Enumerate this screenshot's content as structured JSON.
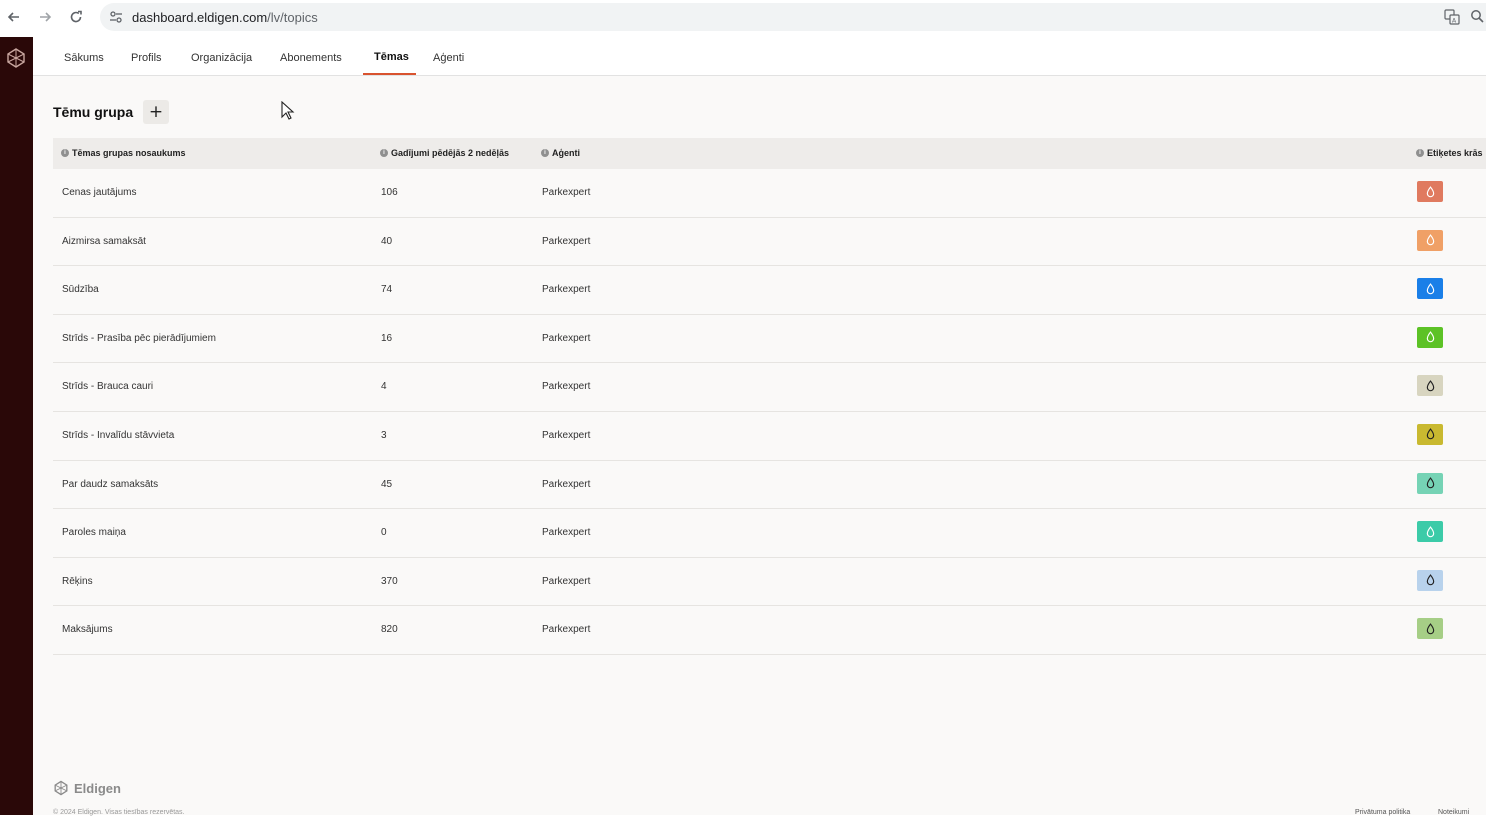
{
  "browser": {
    "url_host": "dashboard.eldigen.com",
    "url_path": "/lv/topics"
  },
  "tabs": [
    {
      "label": "Sākums",
      "active": false
    },
    {
      "label": "Profils",
      "active": false
    },
    {
      "label": "Organizācija",
      "active": false
    },
    {
      "label": "Abonements",
      "active": false
    },
    {
      "label": "Tēmas",
      "active": true
    },
    {
      "label": "Aģenti",
      "active": false
    }
  ],
  "section": {
    "title": "Tēmu grupa",
    "add_label": "+"
  },
  "table": {
    "columns": [
      "Tēmas grupas nosaukums",
      "Gadījumi pēdējās 2 nedēļās",
      "Aģenti",
      "Etiķetes krās"
    ],
    "rows": [
      {
        "name": "Cenas jautājums",
        "cases": "106",
        "agent": "Parkexpert",
        "color": "#e07a5f"
      },
      {
        "name": "Aizmirsa samaksāt",
        "cases": "40",
        "agent": "Parkexpert",
        "color": "#f0a066"
      },
      {
        "name": "Sūdzība",
        "cases": "74",
        "agent": "Parkexpert",
        "color": "#1a7fe8"
      },
      {
        "name": "Strīds - Prasība pēc pierādījumiem",
        "cases": "16",
        "agent": "Parkexpert",
        "color": "#5cc226"
      },
      {
        "name": "Strīds - Brauca cauri",
        "cases": "4",
        "agent": "Parkexpert",
        "color": "#d8d5c0"
      },
      {
        "name": "Strīds - Invalīdu stāvvieta",
        "cases": "3",
        "agent": "Parkexpert",
        "color": "#c9b930"
      },
      {
        "name": "Par daudz samaksāts",
        "cases": "45",
        "agent": "Parkexpert",
        "color": "#76d3b5"
      },
      {
        "name": "Paroles maiņa",
        "cases": "0",
        "agent": "Parkexpert",
        "color": "#3ccba8"
      },
      {
        "name": "Rēķins",
        "cases": "370",
        "agent": "Parkexpert",
        "color": "#b8d2ec"
      },
      {
        "name": "Maksājums",
        "cases": "820",
        "agent": "Parkexpert",
        "color": "#a6ce86"
      }
    ]
  },
  "footer": {
    "brand": "Eldigen",
    "copyright": "© 2024 Eldigen. Visas tiesības rezervētas.",
    "privacy": "Privātuma politika",
    "terms": "Noteikumi"
  }
}
